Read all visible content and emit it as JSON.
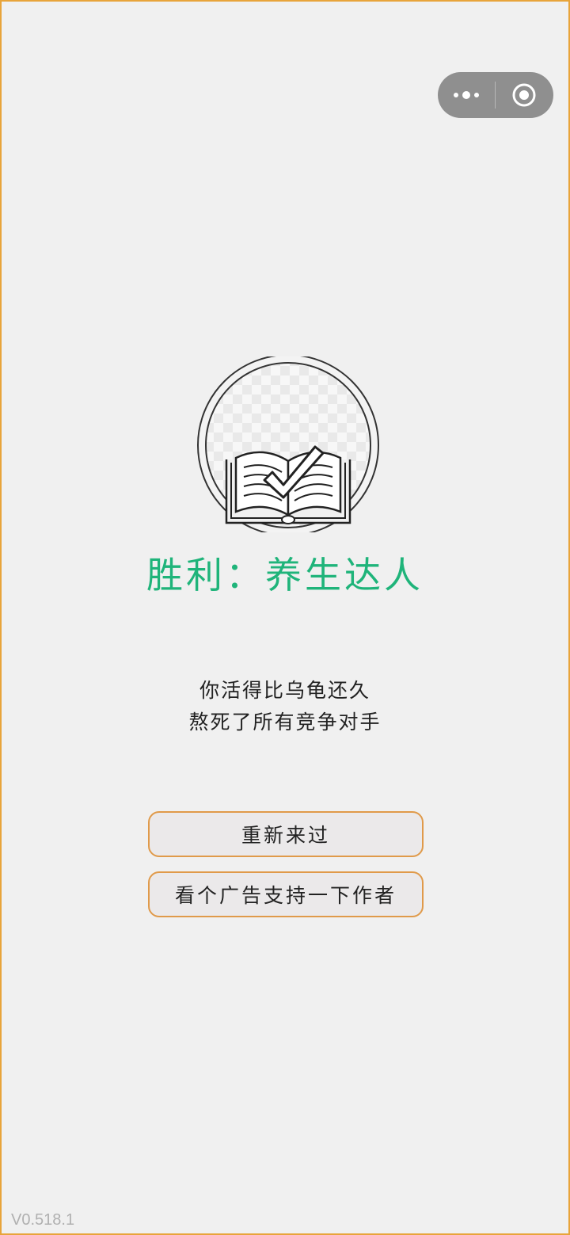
{
  "capsule": {
    "more_icon": "more-dots-icon",
    "close_icon": "target-circle-icon"
  },
  "result": {
    "emblem_icon": "book-checkmark-icon",
    "title": "胜利：养生达人",
    "desc_line1": "你活得比乌龟还久",
    "desc_line2": "熬死了所有竞争对手"
  },
  "buttons": {
    "restart_label": "重新来过",
    "ad_label": "看个广告支持一下作者"
  },
  "footer": {
    "version": "V0.518.1"
  },
  "colors": {
    "title": "#1fb47a",
    "button_border": "#e09a4a",
    "frame_border": "#e8a43a",
    "background": "#f0f0f0"
  }
}
